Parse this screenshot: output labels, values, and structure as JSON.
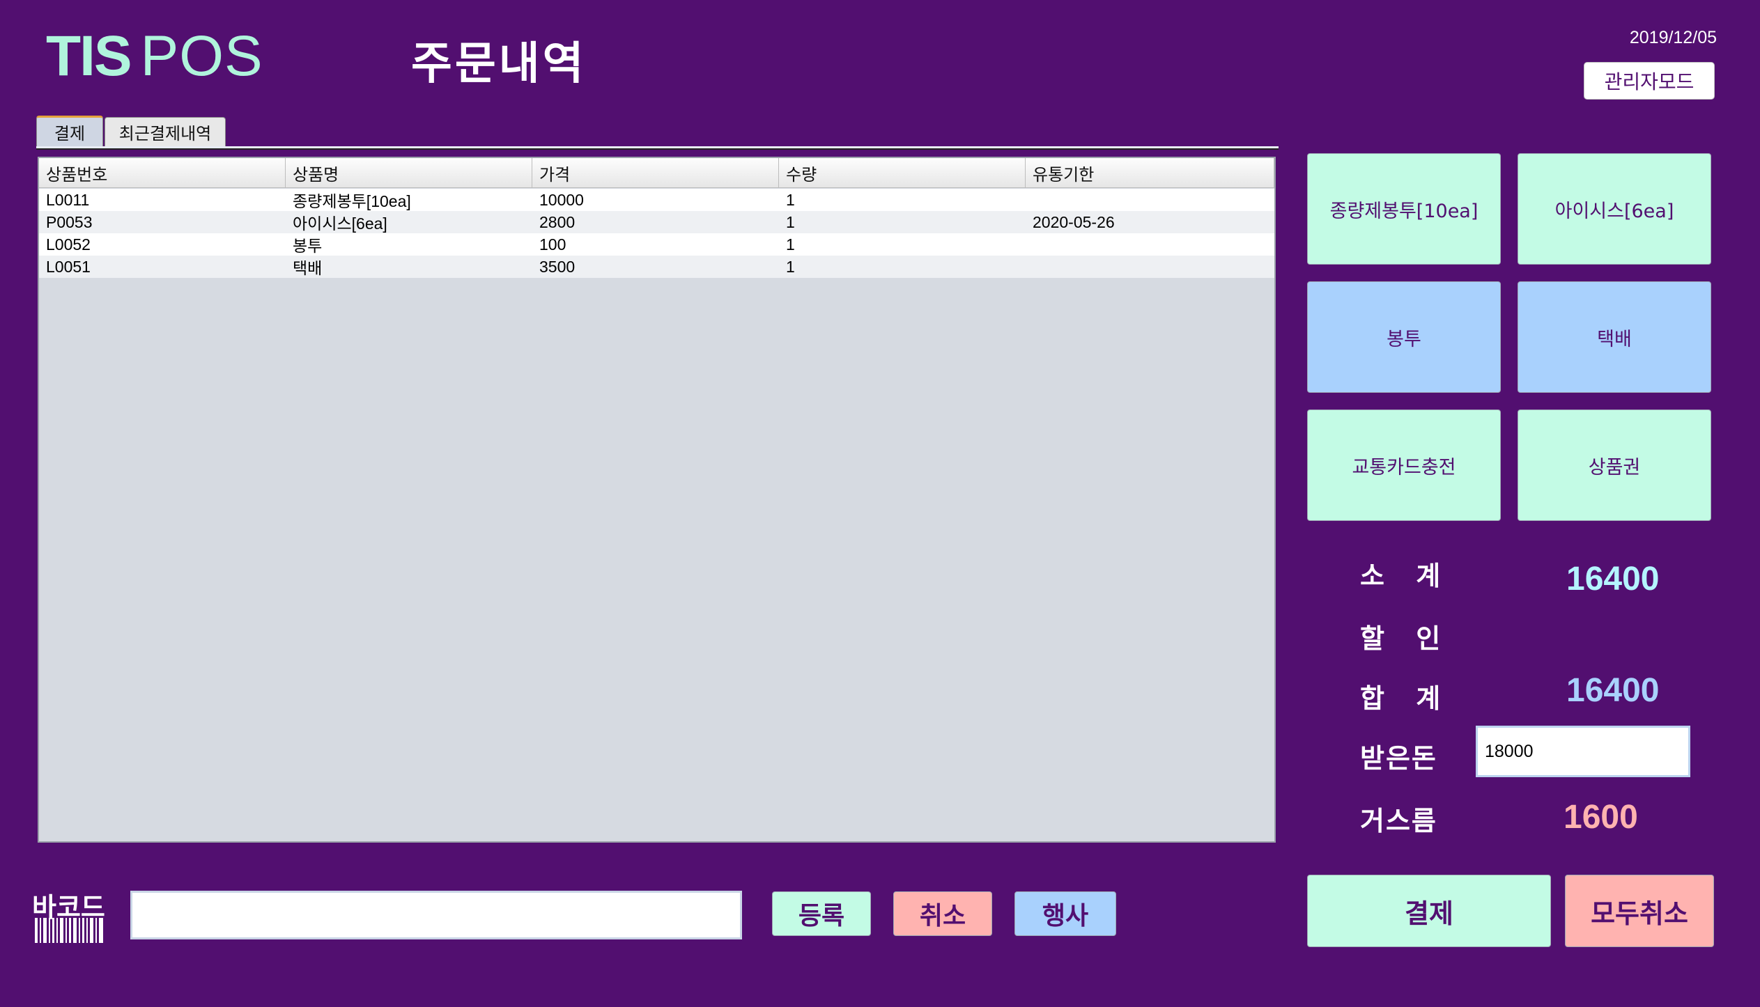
{
  "header": {
    "logo_tis": "TIS",
    "logo_pos": "POS",
    "title": "주문내역",
    "date": "2019/12/05",
    "admin_mode_label": "관리자모드"
  },
  "tabs": [
    {
      "label": "결제",
      "active": true
    },
    {
      "label": "최근결제내역",
      "active": false
    }
  ],
  "table": {
    "columns": [
      "상품번호",
      "상품명",
      "가격",
      "수량",
      "유통기한"
    ],
    "rows": [
      [
        "L0011",
        "종량제봉투[10ea]",
        "10000",
        "1",
        ""
      ],
      [
        "P0053",
        "아이시스[6ea]",
        "2800",
        "1",
        "2020-05-26"
      ],
      [
        "L0052",
        "봉투",
        "100",
        "1",
        ""
      ],
      [
        "L0051",
        "택배",
        "3500",
        "1",
        ""
      ]
    ]
  },
  "products": [
    {
      "label": "종량제봉투[10ea]",
      "color": "#c3fbe5"
    },
    {
      "label": "아이시스[6ea]",
      "color": "#c3fbe5"
    },
    {
      "label": "봉투",
      "color": "#a9d1fd"
    },
    {
      "label": "택배",
      "color": "#a9d1fd"
    },
    {
      "label": "교통카드충전",
      "color": "#c3fbe5"
    },
    {
      "label": "상품권",
      "color": "#c3fbe5"
    }
  ],
  "totals": {
    "subtotal_label": "소 계",
    "subtotal_value": "16400",
    "discount_label": "할 인",
    "discount_value": "",
    "total_label": "합 계",
    "total_value": "16400",
    "received_label": "받은돈",
    "received_value": "18000",
    "change_label": "거스름",
    "change_value": "1600"
  },
  "bottom": {
    "barcode_label": "바코드",
    "barcode_value": "",
    "register_label": "등록",
    "cancel_label": "취소",
    "event_label": "행사",
    "pay_label": "결제",
    "cancel_all_label": "모두취소"
  },
  "colors": {
    "background": "#520f70",
    "mint": "#c3fbe5",
    "blue": "#a9d1fd",
    "pink": "#ffb3b0",
    "subtotal_value": "#b4f4ff",
    "total_value": "#a9d1fd",
    "change_value": "#ffb3b0"
  }
}
